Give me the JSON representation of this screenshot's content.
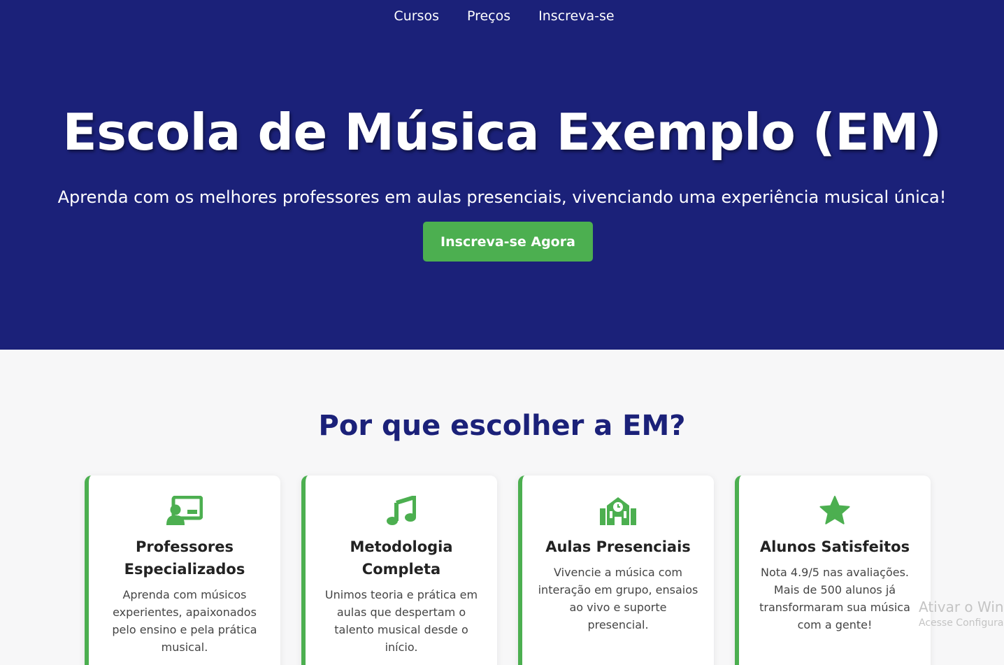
{
  "nav": {
    "items": [
      "Cursos",
      "Preços",
      "Inscreva-se"
    ]
  },
  "hero": {
    "title": "Escola de Música Exemplo (EM)",
    "subtitle": "Aprenda com os melhores professores em aulas presenciais, vivenciando uma experiência musical única!",
    "cta_label": "Inscreva-se Agora"
  },
  "features": {
    "title": "Por que escolher a EM?",
    "cards": [
      {
        "icon": "teacher-icon",
        "title": "Professores Especializados",
        "text": "Aprenda com músicos experientes, apaixonados pelo ensino e pela prática musical."
      },
      {
        "icon": "music-note-icon",
        "title": "Metodologia Completa",
        "text": "Unimos teoria e prática em aulas que despertam o talento musical desde o início."
      },
      {
        "icon": "school-building-icon",
        "title": "Aulas Presenciais",
        "text": "Vivencie a música com interação em grupo, ensaios ao vivo e suporte presencial."
      },
      {
        "icon": "star-icon",
        "title": "Alunos Satisfeitos",
        "text": "Nota 4.9/5 nas avaliações. Mais de 500 alunos já transformaram sua música com a gente!"
      }
    ]
  },
  "watermark": {
    "line1": "Ativar o Wind",
    "line2": "Acesse Configuraç"
  },
  "colors": {
    "hero_bg": "#1b2179",
    "accent": "#4caf50",
    "title_blue": "#1b2179"
  }
}
